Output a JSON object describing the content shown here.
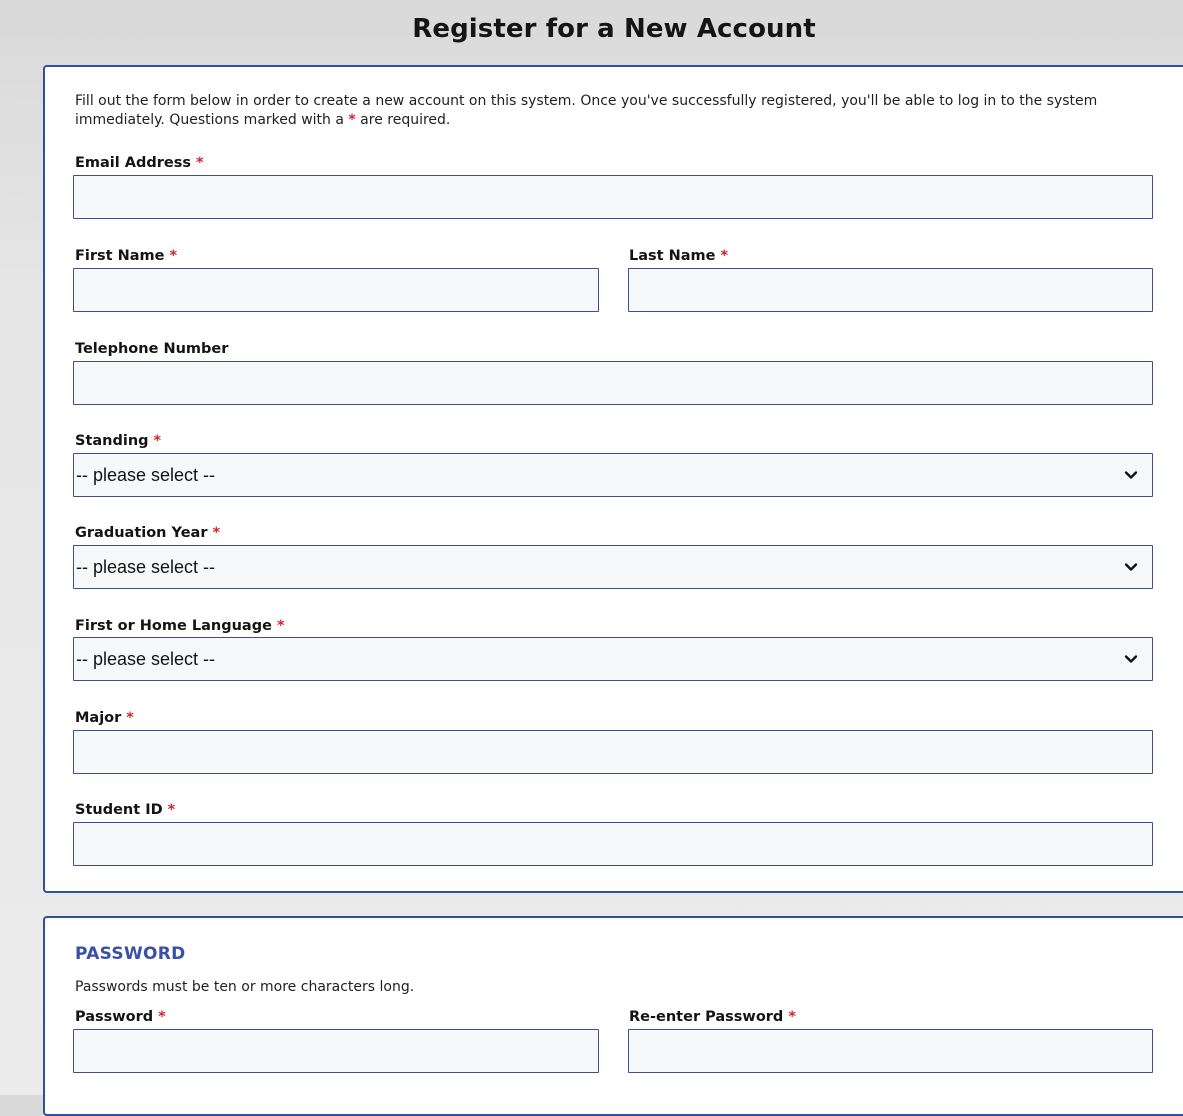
{
  "page": {
    "title": "Register for a New Account"
  },
  "form": {
    "intro_before": "Fill out the form below in order to create a new account on this system. Once you've successfully registered, you'll be able to log in to the system immediately. Questions marked with a ",
    "intro_star": "*",
    "intro_after": " are required.",
    "required_mark": "*",
    "fields": {
      "email": {
        "label": "Email Address",
        "value": "",
        "required": true
      },
      "first_name": {
        "label": "First Name",
        "value": "",
        "required": true
      },
      "last_name": {
        "label": "Last Name",
        "value": "",
        "required": true
      },
      "telephone": {
        "label": "Telephone Number",
        "value": "",
        "required": false
      },
      "standing": {
        "label": "Standing",
        "selected": "-- please select --",
        "required": true
      },
      "graduation_year": {
        "label": "Graduation Year",
        "selected": "-- please select --",
        "required": true
      },
      "language": {
        "label": "First or Home Language",
        "selected": "-- please select --",
        "required": true
      },
      "major": {
        "label": "Major",
        "value": "",
        "required": true
      },
      "student_id": {
        "label": "Student ID",
        "value": "",
        "required": true
      }
    }
  },
  "password_section": {
    "heading": "PASSWORD",
    "helper": "Passwords must be ten or more characters long.",
    "fields": {
      "password": {
        "label": "Password",
        "value": "",
        "required": true
      },
      "confirm": {
        "label": "Re-enter Password",
        "value": "",
        "required": true
      }
    }
  },
  "colors": {
    "accent_border": "#3a4f96",
    "heading_blue": "#3a51a3",
    "required_red": "#d1242f",
    "input_bg": "#f7f8fa"
  },
  "icons": {
    "select_chevron": "chevron-down-icon"
  }
}
